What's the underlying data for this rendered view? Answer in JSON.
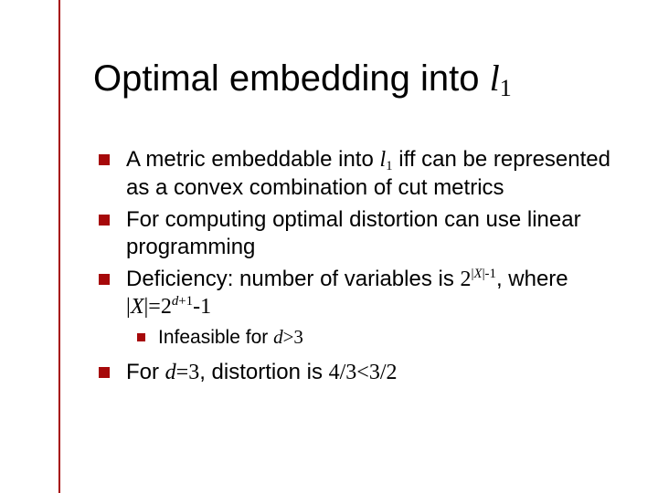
{
  "title": {
    "prefix": "Optimal embedding into ",
    "l": "l",
    "sub": "1"
  },
  "bullets": [
    {
      "parts": [
        "A metric embeddable into ",
        "l",
        "1",
        " iff can be represented as a convex combination of cut metrics"
      ]
    },
    {
      "text": "For computing optimal distortion can use linear programming"
    },
    {
      "parts_a": "Deficiency: number of variables is ",
      "two": "2",
      "exp1": "|",
      "expX": "X",
      "exp2": "|-1",
      "mid": ", where ",
      "absX": "|",
      "Xch": "X",
      "abs2": "|=2",
      "dexp": "d",
      "plus1": "+1",
      "tail": "-1"
    },
    {
      "sub_prefix": "Infeasible for ",
      "d": "d",
      "gt3": ">3"
    },
    {
      "for": "For ",
      "d": "d",
      "eq3": "=3",
      "dist": ", distortion is ",
      "frac": "4/3<3/2"
    }
  ]
}
